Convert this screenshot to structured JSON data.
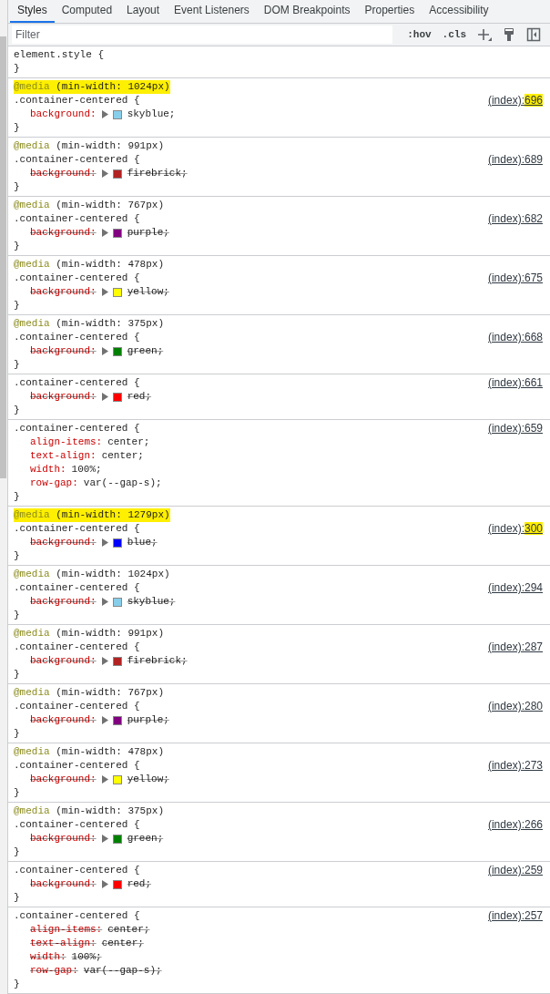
{
  "tabs": [
    {
      "label": "Styles",
      "selected": true
    },
    {
      "label": "Computed",
      "selected": false
    },
    {
      "label": "Layout",
      "selected": false
    },
    {
      "label": "Event Listeners",
      "selected": false
    },
    {
      "label": "DOM Breakpoints",
      "selected": false
    },
    {
      "label": "Properties",
      "selected": false
    },
    {
      "label": "Accessibility",
      "selected": false
    }
  ],
  "filter": {
    "placeholder": "Filter"
  },
  "toolbar": [
    {
      "kind": "text",
      "label": ":hov"
    },
    {
      "kind": "text",
      "label": ".cls"
    },
    {
      "kind": "plus"
    },
    {
      "kind": "brush"
    },
    {
      "kind": "sidebar"
    }
  ],
  "rules": [
    {
      "selector": "element.style {",
      "close": "}"
    },
    {
      "media_keyword": "@media",
      "media_query": "(min-width: 1024px)",
      "highlighted": true,
      "selector": ".container-centered {",
      "close": "}",
      "source": "(index):",
      "line": "696",
      "properties": [
        {
          "name": "background:",
          "value": "skyblue;",
          "overridden": false,
          "color": "#87ceeb"
        }
      ]
    },
    {
      "media_keyword": "@media",
      "media_query": "(min-width: 991px)",
      "highlighted": false,
      "selector": ".container-centered {",
      "close": "}",
      "source": "(index):",
      "line": "689",
      "properties": [
        {
          "name": "background:",
          "value": "firebrick;",
          "overridden": true,
          "color": "#b22222"
        }
      ]
    },
    {
      "media_keyword": "@media",
      "media_query": "(min-width: 767px)",
      "highlighted": false,
      "selector": ".container-centered {",
      "close": "}",
      "source": "(index):",
      "line": "682",
      "properties": [
        {
          "name": "background:",
          "value": "purple;",
          "overridden": true,
          "color": "#800080"
        }
      ]
    },
    {
      "media_keyword": "@media",
      "media_query": "(min-width: 478px)",
      "highlighted": false,
      "selector": ".container-centered {",
      "close": "}",
      "source": "(index):",
      "line": "675",
      "properties": [
        {
          "name": "background:",
          "value": "yellow;",
          "overridden": true,
          "color": "#ffff00"
        }
      ]
    },
    {
      "media_keyword": "@media",
      "media_query": "(min-width: 375px)",
      "highlighted": false,
      "selector": ".container-centered {",
      "close": "}",
      "source": "(index):",
      "line": "668",
      "properties": [
        {
          "name": "background:",
          "value": "green;",
          "overridden": true,
          "color": "#008000"
        }
      ]
    },
    {
      "selector": ".container-centered {",
      "close": "}",
      "source": "(index):",
      "line": "661",
      "properties": [
        {
          "name": "background:",
          "value": "red;",
          "overridden": true,
          "color": "#ff0000"
        }
      ]
    },
    {
      "selector": ".container-centered {",
      "close": "}",
      "source": "(index):",
      "line": "659",
      "properties": [
        {
          "name": "align-items:",
          "value": "center;",
          "overridden": false
        },
        {
          "name": "text-align:",
          "value": "center;",
          "overridden": false
        },
        {
          "name": "width:",
          "value": "100%;",
          "overridden": false
        },
        {
          "name": "row-gap:",
          "value": "var(--gap-s);",
          "overridden": false
        }
      ]
    },
    {
      "media_keyword": "@media",
      "media_query": "(min-width: 1279px)",
      "highlighted": true,
      "selector": ".container-centered {",
      "close": "}",
      "source": "(index):",
      "line": "300",
      "properties": [
        {
          "name": "background:",
          "value": "blue;",
          "overridden": true,
          "color": "#0000ff"
        }
      ]
    },
    {
      "media_keyword": "@media",
      "media_query": "(min-width: 1024px)",
      "highlighted": false,
      "selector": ".container-centered {",
      "close": "}",
      "source": "(index):",
      "line": "294",
      "properties": [
        {
          "name": "background:",
          "value": "skyblue;",
          "overridden": true,
          "color": "#87ceeb"
        }
      ]
    },
    {
      "media_keyword": "@media",
      "media_query": "(min-width: 991px)",
      "highlighted": false,
      "selector": ".container-centered {",
      "close": "}",
      "source": "(index):",
      "line": "287",
      "properties": [
        {
          "name": "background:",
          "value": "firebrick;",
          "overridden": true,
          "color": "#b22222"
        }
      ]
    },
    {
      "media_keyword": "@media",
      "media_query": "(min-width: 767px)",
      "highlighted": false,
      "selector": ".container-centered {",
      "close": "}",
      "source": "(index):",
      "line": "280",
      "properties": [
        {
          "name": "background:",
          "value": "purple;",
          "overridden": true,
          "color": "#800080"
        }
      ]
    },
    {
      "media_keyword": "@media",
      "media_query": "(min-width: 478px)",
      "highlighted": false,
      "selector": ".container-centered {",
      "close": "}",
      "source": "(index):",
      "line": "273",
      "properties": [
        {
          "name": "background:",
          "value": "yellow;",
          "overridden": true,
          "color": "#ffff00"
        }
      ]
    },
    {
      "media_keyword": "@media",
      "media_query": "(min-width: 375px)",
      "highlighted": false,
      "selector": ".container-centered {",
      "close": "}",
      "source": "(index):",
      "line": "266",
      "properties": [
        {
          "name": "background:",
          "value": "green;",
          "overridden": true,
          "color": "#008000"
        }
      ]
    },
    {
      "selector": ".container-centered {",
      "close": "}",
      "source": "(index):",
      "line": "259",
      "properties": [
        {
          "name": "background:",
          "value": "red;",
          "overridden": true,
          "color": "#ff0000"
        }
      ]
    },
    {
      "selector": ".container-centered {",
      "close": "}",
      "source": "(index):",
      "line": "257",
      "properties": [
        {
          "name": "align-items:",
          "value": "center;",
          "overridden": true
        },
        {
          "name": "text-align:",
          "value": "center;",
          "overridden": true
        },
        {
          "name": "width:",
          "value": "100%;",
          "overridden": true
        },
        {
          "name": "row-gap:",
          "value": "var(--gap-s);",
          "overridden": true
        }
      ]
    }
  ]
}
